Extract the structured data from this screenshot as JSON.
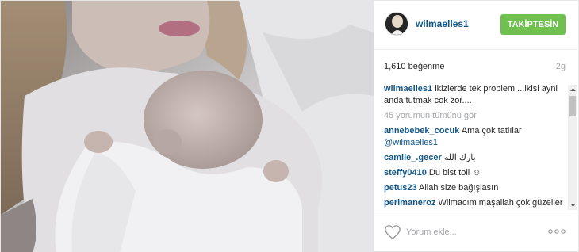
{
  "post": {
    "photo_alt": "",
    "username": "wilmaelles1",
    "follow_label": "TAKİPTESİN",
    "likes": "1,610 beğenme",
    "time_ago": "2g",
    "caption": {
      "user": "wilmaelles1",
      "text": "ikizlerde tek problem ...ikisi ayni anda tutmak cok zor...."
    },
    "view_all": "45 yorumun tümünü gör",
    "comments": [
      {
        "user": "annebebek_cocuk",
        "text": "Ama çok tatlılar",
        "mention": "@wilmaelles1"
      },
      {
        "user": "camile_.gecer",
        "text": "بارك الله"
      },
      {
        "user": "steffy0410",
        "text": "Du bist toll ☺"
      },
      {
        "user": "petus23",
        "text": "Allah size bağışlasın"
      },
      {
        "user": "perimaneroz",
        "text": "Wilmacım maşallah çok güzeller"
      }
    ],
    "comment_placeholder": "Yorum ekle...",
    "colors": {
      "link": "#125688",
      "follow_button": "#70c050",
      "muted": "#a5a7aa"
    },
    "icons": {
      "like": "heart-icon",
      "options": "more-options-icon"
    }
  }
}
